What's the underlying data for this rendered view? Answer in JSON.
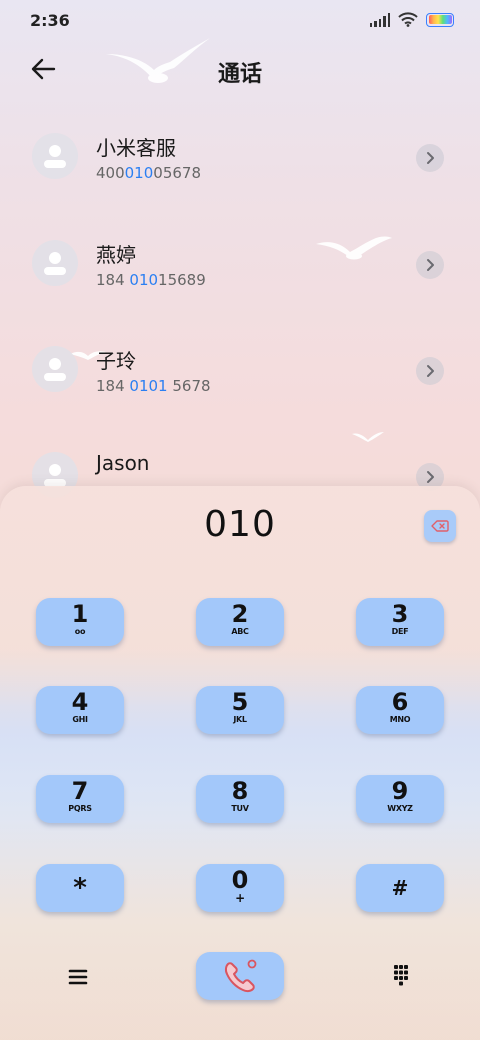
{
  "status_bar": {
    "time": "2:36"
  },
  "header": {
    "title": "通话"
  },
  "contacts": [
    {
      "name": "小米客服",
      "number_pre": "400",
      "number_match": "010",
      "number_post": "05678"
    },
    {
      "name": "燕婷",
      "number_pre": "184 ",
      "number_match": "010",
      "number_post": "15689"
    },
    {
      "name": "子玲",
      "number_pre": "184 ",
      "number_match": "0101",
      "number_post": " 5678"
    },
    {
      "name": "Jason",
      "number_pre": "",
      "number_match": "",
      "number_post": ""
    }
  ],
  "dialer": {
    "input_value": "010",
    "keys": [
      {
        "digit": "1",
        "letters": "oo"
      },
      {
        "digit": "2",
        "letters": "ABC"
      },
      {
        "digit": "3",
        "letters": "DEF"
      },
      {
        "digit": "4",
        "letters": "GHI"
      },
      {
        "digit": "5",
        "letters": "JKL"
      },
      {
        "digit": "6",
        "letters": "MNO"
      },
      {
        "digit": "7",
        "letters": "PQRS"
      },
      {
        "digit": "8",
        "letters": "TUV"
      },
      {
        "digit": "9",
        "letters": "WXYZ"
      },
      {
        "digit": "*",
        "letters": ""
      },
      {
        "digit": "0",
        "letters": "+"
      },
      {
        "digit": "#",
        "letters": ""
      }
    ]
  },
  "icons": {
    "back": "arrow-left-icon",
    "detail": "chevron-right-icon",
    "delete": "backspace-icon",
    "call": "phone-icon",
    "menu": "hamburger-menu-icon",
    "keypad": "dialpad-icon"
  },
  "colors": {
    "key_background": "#a3c8fa",
    "match_highlight": "#2b7ff2",
    "delete_accent": "#e0606a",
    "call_accent": "#e0606a"
  }
}
